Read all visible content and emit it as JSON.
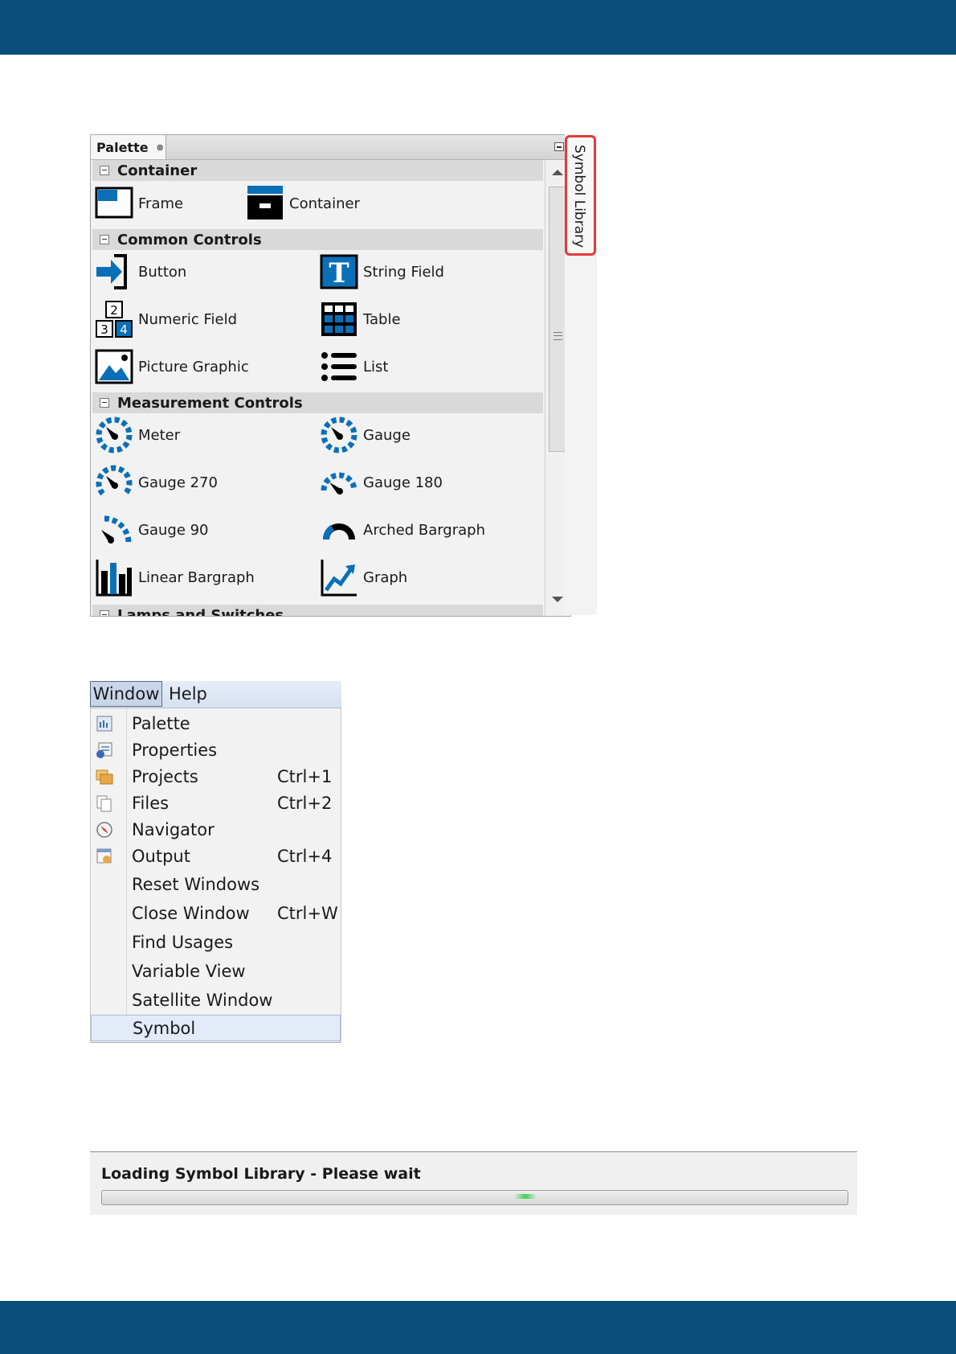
{
  "palette": {
    "tab_label": "Palette",
    "tab_close_glyph": "⊗",
    "side_tab_label": "Symbol Library",
    "categories": [
      {
        "name": "Container",
        "items": [
          {
            "label": "Frame",
            "icon": "frame-icon"
          },
          {
            "label": "Container",
            "icon": "container-icon"
          }
        ]
      },
      {
        "name": "Common Controls",
        "items": [
          {
            "label": "Button",
            "icon": "button-icon"
          },
          {
            "label": "String Field",
            "icon": "string-field-icon"
          },
          {
            "label": "Numeric Field",
            "icon": "numeric-field-icon"
          },
          {
            "label": "Table",
            "icon": "table-icon"
          },
          {
            "label": "Picture Graphic",
            "icon": "picture-graphic-icon"
          },
          {
            "label": "List",
            "icon": "list-icon"
          }
        ]
      },
      {
        "name": "Measurement Controls",
        "items": [
          {
            "label": "Meter",
            "icon": "meter-icon"
          },
          {
            "label": "Gauge",
            "icon": "gauge-icon"
          },
          {
            "label": "Gauge 270",
            "icon": "gauge-270-icon"
          },
          {
            "label": "Gauge 180",
            "icon": "gauge-180-icon"
          },
          {
            "label": "Gauge 90",
            "icon": "gauge-90-icon"
          },
          {
            "label": "Arched Bargraph",
            "icon": "arched-bargraph-icon"
          },
          {
            "label": "Linear Bargraph",
            "icon": "linear-bargraph-icon"
          },
          {
            "label": "Graph",
            "icon": "graph-icon"
          }
        ]
      },
      {
        "name": "Lamps and Switches",
        "items": []
      }
    ]
  },
  "menu": {
    "menubar": [
      "Window",
      "Help"
    ],
    "items": [
      {
        "label": "Palette",
        "shortcut": "",
        "icon": "palette-icon"
      },
      {
        "label": "Properties",
        "shortcut": "",
        "icon": "properties-icon"
      },
      {
        "label": "Projects",
        "shortcut": "Ctrl+1",
        "icon": "projects-icon"
      },
      {
        "label": "Files",
        "shortcut": "Ctrl+2",
        "icon": "files-icon"
      },
      {
        "label": "Navigator",
        "shortcut": "",
        "icon": "navigator-icon"
      },
      {
        "label": "Output",
        "shortcut": "Ctrl+4",
        "icon": "output-icon"
      },
      {
        "label": "Reset Windows",
        "shortcut": ""
      },
      {
        "label": "Close Window",
        "shortcut": "Ctrl+W"
      },
      {
        "label": "Find Usages",
        "shortcut": ""
      },
      {
        "label": "Variable View",
        "shortcut": ""
      },
      {
        "label": "Satellite Window",
        "shortcut": ""
      },
      {
        "label": "Symbol",
        "shortcut": "",
        "highlighted": true
      }
    ]
  },
  "loading": {
    "title": "Loading Symbol Library - Please wait",
    "progress_fraction": 0.57
  },
  "colors": {
    "band": "#0a4f7c",
    "icon_blue": "#0b6fb8",
    "highlight_border": "#e23a3a",
    "progress_glow": "#3fcf5a"
  }
}
